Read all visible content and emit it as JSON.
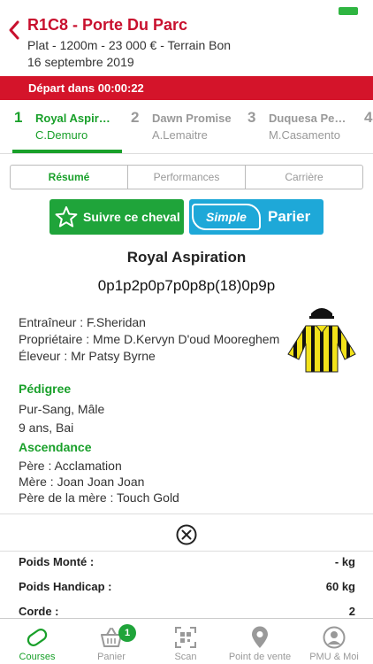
{
  "header": {
    "title": "R1C8 - Porte Du Parc",
    "subtitle": "Plat - 1200m - 23 000 € - Terrain Bon",
    "date": "16 septembre 2019"
  },
  "countdown": "Départ dans 00:00:22",
  "runners": [
    {
      "num": "1",
      "name": "Royal Aspir…",
      "jockey": "C.Demuro",
      "active": true
    },
    {
      "num": "2",
      "name": "Dawn Promise",
      "jockey": "A.Lemaitre",
      "active": false
    },
    {
      "num": "3",
      "name": "Duquesa Pe…",
      "jockey": "M.Casamento",
      "active": false
    },
    {
      "num": "4",
      "name": "",
      "jockey": "",
      "active": false
    }
  ],
  "segments": [
    "Résumé",
    "Performances",
    "Carrière"
  ],
  "actions": {
    "follow_label": "Suivre ce cheval",
    "simple_label": "Simple",
    "bet_label": "Parier"
  },
  "horse": {
    "name": "Royal Aspiration",
    "musique": "0p1p2p0p7p0p8p(18)0p9p",
    "trainer": "Entraîneur : F.Sheridan",
    "owner": "Propriétaire : Mme D.Kervyn D'oud Mooreghem",
    "breeder": "Éleveur : Mr Patsy Byrne"
  },
  "pedigree": {
    "title": "Pédigree",
    "breed": "Pur-Sang, Mâle",
    "age": "9 ans, Bai"
  },
  "ascendance": {
    "title": "Ascendance",
    "father": "Père : Acclamation",
    "mother": "Mère : Joan Joan Joan",
    "mother_father": "Père de la mère : Touch Gold"
  },
  "stats": [
    {
      "label": "Poids Monté :",
      "value": "- kg"
    },
    {
      "label": "Poids Handicap :",
      "value": "60 kg"
    },
    {
      "label": "Corde :",
      "value": "2"
    }
  ],
  "tabs": [
    {
      "label": "Courses",
      "icon": "racetrack-icon"
    },
    {
      "label": "Panier",
      "icon": "basket-icon",
      "badge": "1"
    },
    {
      "label": "Scan",
      "icon": "qr-scan-icon"
    },
    {
      "label": "Point de vente",
      "icon": "location-pin-icon"
    },
    {
      "label": "PMU & Moi",
      "icon": "user-icon"
    }
  ],
  "colors": {
    "brand_red": "#c8102e",
    "accent_green": "#19a02a",
    "bet_blue": "#1ea8d8"
  }
}
